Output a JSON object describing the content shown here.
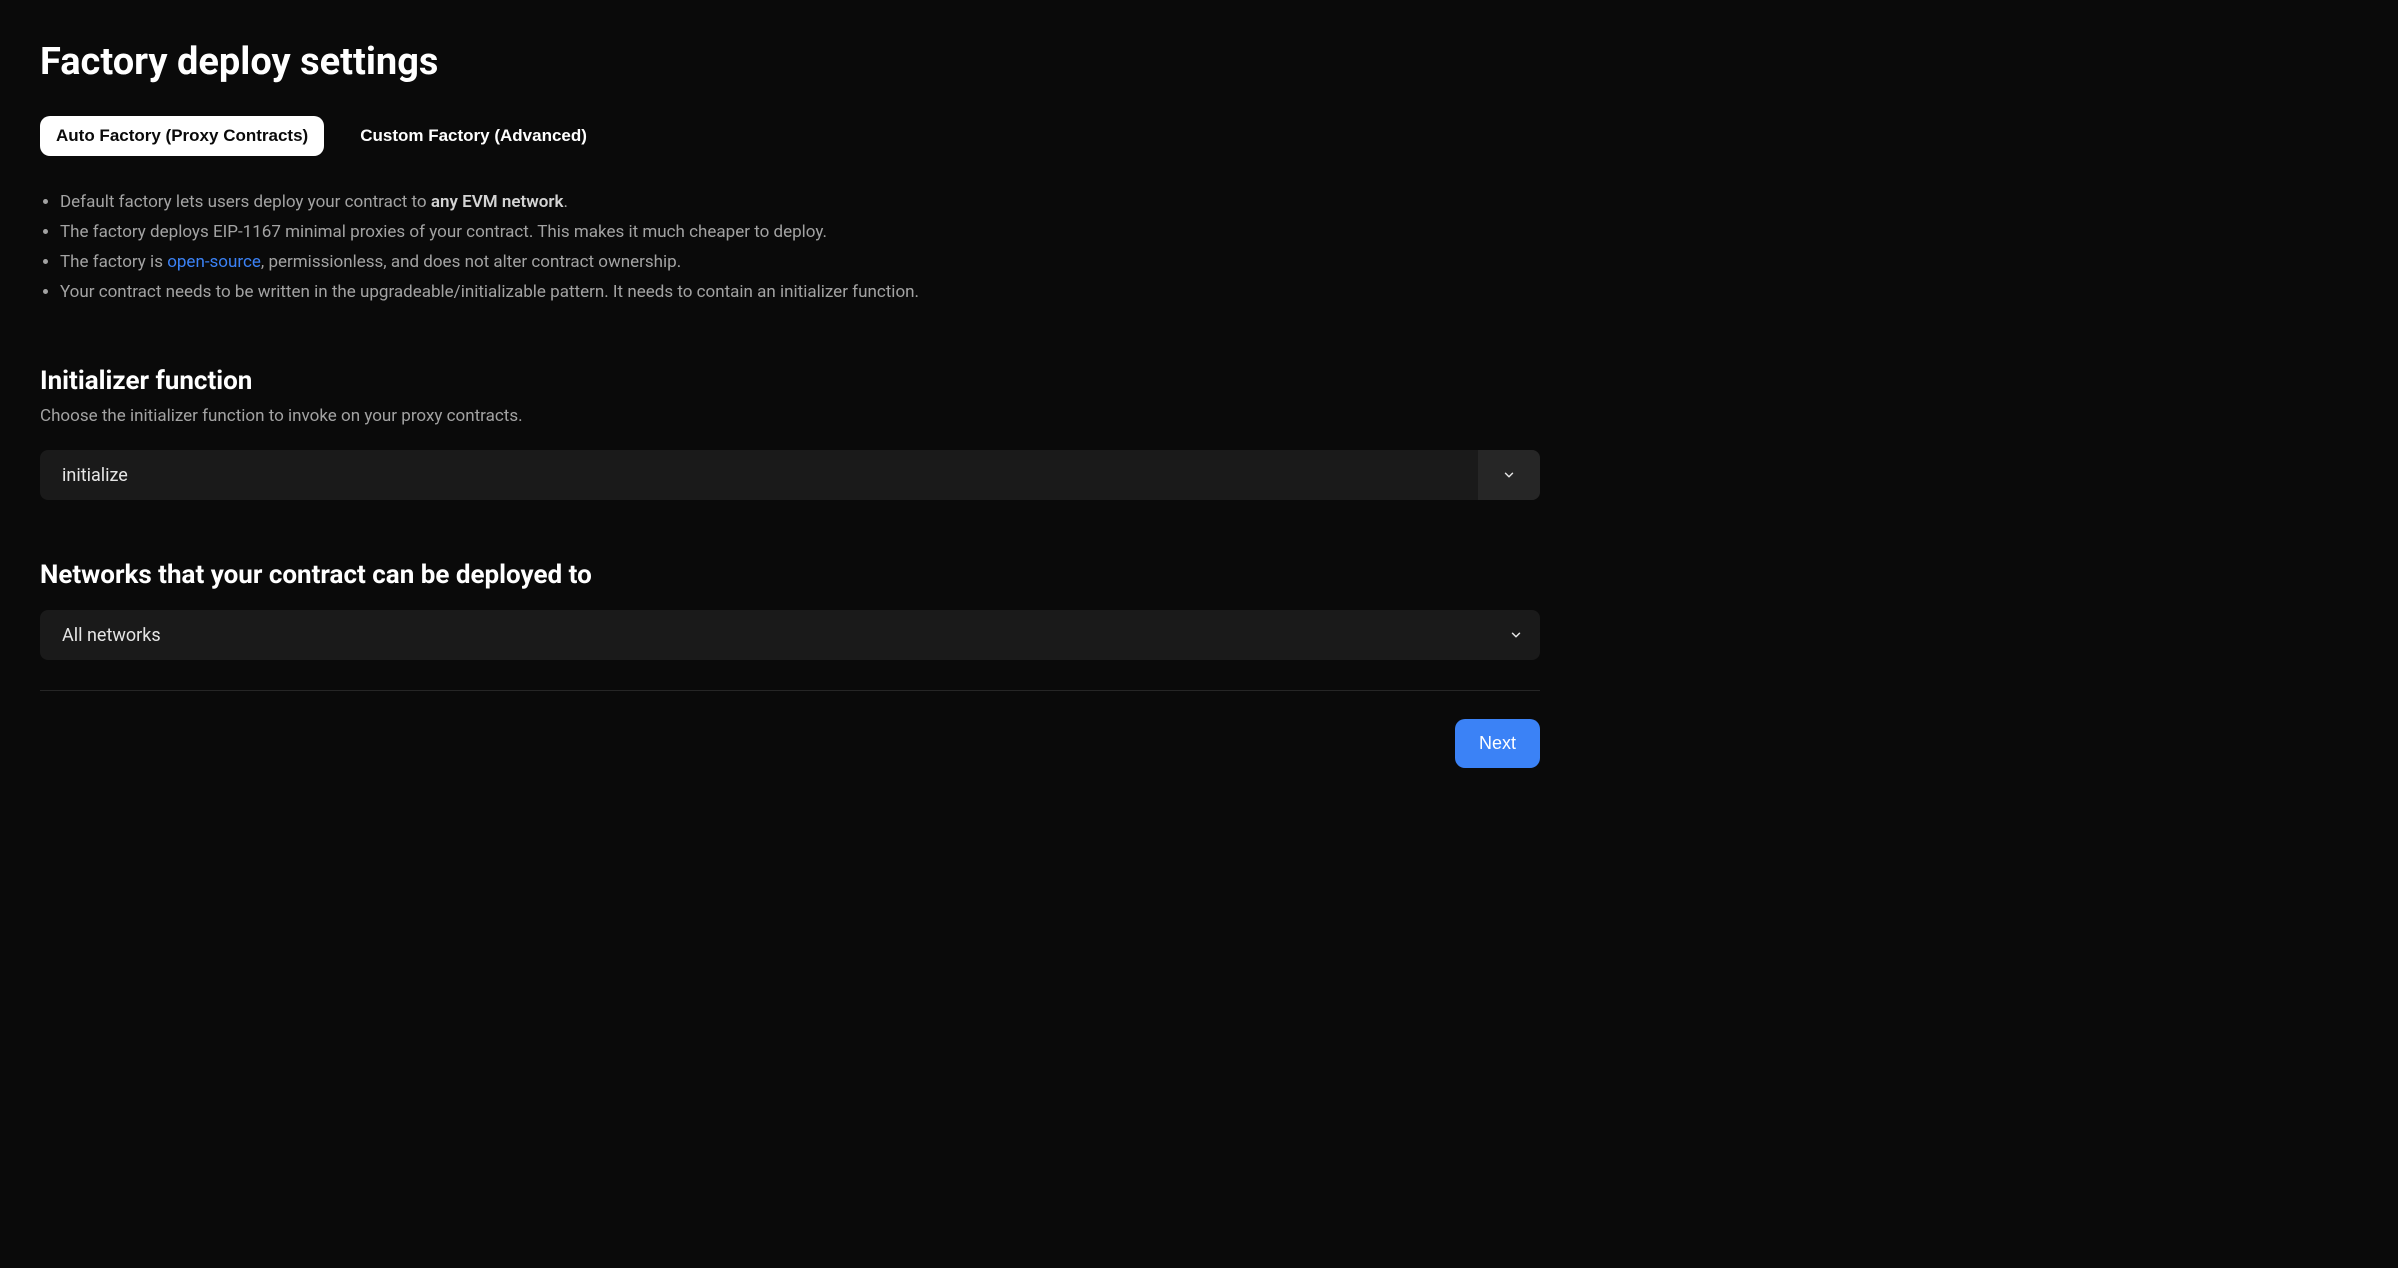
{
  "page": {
    "title": "Factory deploy settings"
  },
  "tabs": {
    "auto": "Auto Factory (Proxy Contracts)",
    "custom": "Custom Factory (Advanced)"
  },
  "bullets": {
    "item1_prefix": "Default factory lets users deploy your contract to ",
    "item1_strong": "any EVM network",
    "item1_suffix": ".",
    "item2": "The factory deploys EIP-1167 minimal proxies of your contract. This makes it much cheaper to deploy.",
    "item3_prefix": "The factory is ",
    "item3_link": "open-source",
    "item3_suffix": ", permissionless, and does not alter contract ownership.",
    "item4": "Your contract needs to be written in the upgradeable/initializable pattern. It needs to contain an initializer function."
  },
  "initializer": {
    "title": "Initializer function",
    "description": "Choose the initializer function to invoke on your proxy contracts.",
    "value": "initialize"
  },
  "networks": {
    "title": "Networks that your contract can be deployed to",
    "value": "All networks"
  },
  "footer": {
    "next": "Next"
  }
}
